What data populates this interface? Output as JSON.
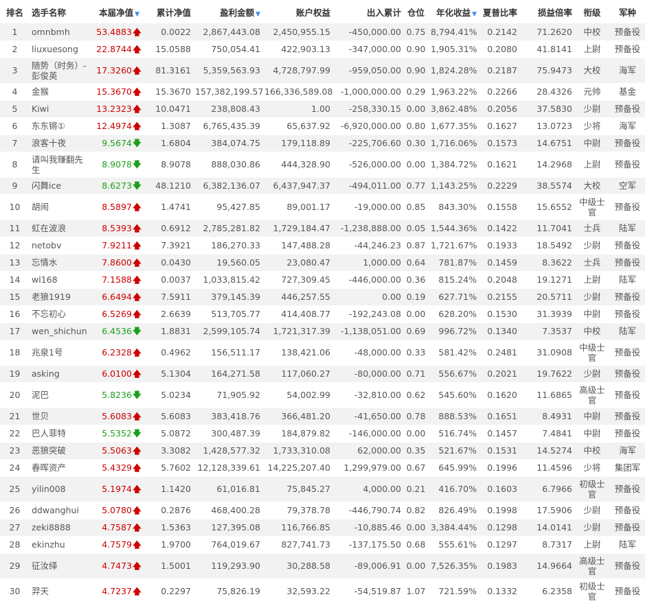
{
  "columns": [
    {
      "label": "排名",
      "sorted": false
    },
    {
      "label": "选手名称",
      "sorted": false
    },
    {
      "label": "本届净值",
      "sorted": true
    },
    {
      "label": "累计净值",
      "sorted": false
    },
    {
      "label": "盈利金额",
      "sorted": true
    },
    {
      "label": "账户权益",
      "sorted": false
    },
    {
      "label": "出入累计",
      "sorted": false
    },
    {
      "label": "仓位",
      "sorted": false
    },
    {
      "label": "年化收益",
      "sorted": true
    },
    {
      "label": "夏普比率",
      "sorted": false
    },
    {
      "label": "损益倍率",
      "sorted": false
    },
    {
      "label": "衔级",
      "sorted": false
    },
    {
      "label": "军种",
      "sorted": false
    }
  ],
  "sort_indicator": "▼",
  "arrows": {
    "up": "🡅",
    "down": "🡇"
  },
  "colors": {
    "up": "#cc0000",
    "down": "#1aa01a",
    "sort": "#3a8ee6",
    "stripe": "#f2f2f2"
  },
  "rows": [
    {
      "rank": "1",
      "name": "omnbmh",
      "nav": "53.4883",
      "dir": "up",
      "cum": "0.0022",
      "profit": "2,867,443.08",
      "equity": "2,450,955.15",
      "flow": "-450,000.00",
      "pos": "0.75",
      "annual": "8,794.41%",
      "sharpe": "0.2142",
      "pl": "71.2620",
      "rank_title": "中校",
      "branch": "预备役"
    },
    {
      "rank": "2",
      "name": "liuxuesong",
      "nav": "22.8744",
      "dir": "up",
      "cum": "15.0588",
      "profit": "750,054.41",
      "equity": "422,903.13",
      "flow": "-347,000.00",
      "pos": "0.90",
      "annual": "1,905.31%",
      "sharpe": "0.2080",
      "pl": "41.8141",
      "rank_title": "上尉",
      "branch": "预备役"
    },
    {
      "rank": "3",
      "name": "随势（时务）-彭俊英",
      "nav": "17.3260",
      "dir": "up",
      "cum": "81.3161",
      "profit": "5,359,563.93",
      "equity": "4,728,797.99",
      "flow": "-959,050.00",
      "pos": "0.90",
      "annual": "1,824.28%",
      "sharpe": "0.2187",
      "pl": "75.9473",
      "rank_title": "大校",
      "branch": "海军"
    },
    {
      "rank": "4",
      "name": "金猴",
      "nav": "15.3670",
      "dir": "up",
      "cum": "15.3670",
      "profit": "157,382,199.57",
      "equity": "166,336,589.08",
      "flow": "-1,000,000.00",
      "pos": "0.29",
      "annual": "1,963.22%",
      "sharpe": "0.2266",
      "pl": "28.4326",
      "rank_title": "元帅",
      "branch": "基金"
    },
    {
      "rank": "5",
      "name": "Kiwi",
      "nav": "13.2323",
      "dir": "up",
      "cum": "10.0471",
      "profit": "238,808.43",
      "equity": "1.00",
      "flow": "-258,330.15",
      "pos": "0.00",
      "annual": "3,862.48%",
      "sharpe": "0.2056",
      "pl": "37.5830",
      "rank_title": "少尉",
      "branch": "预备役"
    },
    {
      "rank": "6",
      "name": "东东锵①",
      "nav": "12.4974",
      "dir": "up",
      "cum": "1.3087",
      "profit": "6,765,435.39",
      "equity": "65,637.92",
      "flow": "-6,920,000.00",
      "pos": "0.80",
      "annual": "1,677.35%",
      "sharpe": "0.1627",
      "pl": "13.0723",
      "rank_title": "少将",
      "branch": "海军"
    },
    {
      "rank": "7",
      "name": "浪客十夜",
      "nav": "9.5674",
      "dir": "down",
      "cum": "1.6804",
      "profit": "384,074.75",
      "equity": "179,118.89",
      "flow": "-225,706.60",
      "pos": "0.30",
      "annual": "1,716.06%",
      "sharpe": "0.1573",
      "pl": "14.6751",
      "rank_title": "中尉",
      "branch": "预备役"
    },
    {
      "rank": "8",
      "name": "请叫我赚翻先生",
      "nav": "8.9078",
      "dir": "down",
      "cum": "8.9078",
      "profit": "888,030.86",
      "equity": "444,328.90",
      "flow": "-526,000.00",
      "pos": "0.00",
      "annual": "1,384.72%",
      "sharpe": "0.1621",
      "pl": "14.2968",
      "rank_title": "上尉",
      "branch": "预备役"
    },
    {
      "rank": "9",
      "name": "闪舞ice",
      "nav": "8.6273",
      "dir": "down",
      "cum": "48.1210",
      "profit": "6,382,136.07",
      "equity": "6,437,947.37",
      "flow": "-494,011.00",
      "pos": "0.77",
      "annual": "1,143.25%",
      "sharpe": "0.2229",
      "pl": "38.5574",
      "rank_title": "大校",
      "branch": "空军"
    },
    {
      "rank": "10",
      "name": "胡闹",
      "nav": "8.5897",
      "dir": "up",
      "cum": "1.4741",
      "profit": "95,427.85",
      "equity": "89,001.17",
      "flow": "-19,000.00",
      "pos": "0.85",
      "annual": "843.30%",
      "sharpe": "0.1558",
      "pl": "15.6552",
      "rank_title": "中级士官",
      "branch": "预备役"
    },
    {
      "rank": "11",
      "name": "虹在波浪",
      "nav": "8.5393",
      "dir": "up",
      "cum": "0.6912",
      "profit": "2,785,281.82",
      "equity": "1,729,184.47",
      "flow": "-1,238,888.00",
      "pos": "0.05",
      "annual": "1,544.36%",
      "sharpe": "0.1422",
      "pl": "11.7041",
      "rank_title": "士兵",
      "branch": "陆军"
    },
    {
      "rank": "12",
      "name": "netobv",
      "nav": "7.9211",
      "dir": "up",
      "cum": "7.3921",
      "profit": "186,270.33",
      "equity": "147,488.28",
      "flow": "-44,246.23",
      "pos": "0.87",
      "annual": "1,721.67%",
      "sharpe": "0.1933",
      "pl": "18.5492",
      "rank_title": "少尉",
      "branch": "预备役"
    },
    {
      "rank": "13",
      "name": "忘情水",
      "nav": "7.8600",
      "dir": "up",
      "cum": "0.0430",
      "profit": "19,560.05",
      "equity": "23,080.47",
      "flow": "1,000.00",
      "pos": "0.64",
      "annual": "781.87%",
      "sharpe": "0.1459",
      "pl": "8.3622",
      "rank_title": "士兵",
      "branch": "预备役"
    },
    {
      "rank": "14",
      "name": "wl168",
      "nav": "7.1588",
      "dir": "up",
      "cum": "0.0037",
      "profit": "1,033,815.42",
      "equity": "727,309.45",
      "flow": "-446,000.00",
      "pos": "0.36",
      "annual": "815.24%",
      "sharpe": "0.2048",
      "pl": "19.1271",
      "rank_title": "上尉",
      "branch": "陆军"
    },
    {
      "rank": "15",
      "name": "老狼1919",
      "nav": "6.6494",
      "dir": "up",
      "cum": "7.5911",
      "profit": "379,145.39",
      "equity": "446,257.55",
      "flow": "0.00",
      "pos": "0.19",
      "annual": "627.71%",
      "sharpe": "0.2155",
      "pl": "20.5711",
      "rank_title": "少尉",
      "branch": "预备役"
    },
    {
      "rank": "16",
      "name": "不忘初心",
      "nav": "6.5269",
      "dir": "up",
      "cum": "2.6639",
      "profit": "513,705.77",
      "equity": "414,408.77",
      "flow": "-192,243.08",
      "pos": "0.00",
      "annual": "628.20%",
      "sharpe": "0.1530",
      "pl": "31.3939",
      "rank_title": "中尉",
      "branch": "预备役"
    },
    {
      "rank": "17",
      "name": "wen_shichun",
      "nav": "6.4536",
      "dir": "down",
      "cum": "1.8831",
      "profit": "2,599,105.74",
      "equity": "1,721,317.39",
      "flow": "-1,138,051.00",
      "pos": "0.69",
      "annual": "996.72%",
      "sharpe": "0.1340",
      "pl": "7.3537",
      "rank_title": "中校",
      "branch": "陆军"
    },
    {
      "rank": "18",
      "name": "兆泉1号",
      "nav": "6.2328",
      "dir": "up",
      "cum": "0.4962",
      "profit": "156,511.17",
      "equity": "138,421.06",
      "flow": "-48,000.00",
      "pos": "0.33",
      "annual": "581.42%",
      "sharpe": "0.2481",
      "pl": "31.0908",
      "rank_title": "中级士官",
      "branch": "预备役"
    },
    {
      "rank": "19",
      "name": "asking",
      "nav": "6.0100",
      "dir": "up",
      "cum": "5.1304",
      "profit": "164,271.58",
      "equity": "117,060.27",
      "flow": "-80,000.00",
      "pos": "0.71",
      "annual": "556.67%",
      "sharpe": "0.2021",
      "pl": "19.7622",
      "rank_title": "少尉",
      "branch": "预备役"
    },
    {
      "rank": "20",
      "name": "泥巴",
      "nav": "5.8236",
      "dir": "down",
      "cum": "5.0234",
      "profit": "71,905.92",
      "equity": "54,002.99",
      "flow": "-32,810.00",
      "pos": "0.62",
      "annual": "545.60%",
      "sharpe": "0.1620",
      "pl": "11.6865",
      "rank_title": "高级士官",
      "branch": "预备役"
    },
    {
      "rank": "21",
      "name": "世贝",
      "nav": "5.6083",
      "dir": "up",
      "cum": "5.6083",
      "profit": "383,418.76",
      "equity": "366,481.20",
      "flow": "-41,650.00",
      "pos": "0.78",
      "annual": "888.53%",
      "sharpe": "0.1651",
      "pl": "8.4931",
      "rank_title": "中尉",
      "branch": "预备役"
    },
    {
      "rank": "22",
      "name": "巴人菲特",
      "nav": "5.5352",
      "dir": "down",
      "cum": "5.0872",
      "profit": "300,487.39",
      "equity": "184,879.82",
      "flow": "-146,000.00",
      "pos": "0.00",
      "annual": "516.74%",
      "sharpe": "0.1457",
      "pl": "7.4841",
      "rank_title": "中尉",
      "branch": "预备役"
    },
    {
      "rank": "23",
      "name": "恶狼突破",
      "nav": "5.5063",
      "dir": "up",
      "cum": "3.3082",
      "profit": "1,428,577.32",
      "equity": "1,733,310.08",
      "flow": "62,000.00",
      "pos": "0.35",
      "annual": "521.67%",
      "sharpe": "0.1531",
      "pl": "14.5274",
      "rank_title": "中校",
      "branch": "海军"
    },
    {
      "rank": "24",
      "name": "春晖资产",
      "nav": "5.4329",
      "dir": "up",
      "cum": "5.7602",
      "profit": "12,128,339.61",
      "equity": "14,225,207.40",
      "flow": "1,299,979.00",
      "pos": "0.67",
      "annual": "645.99%",
      "sharpe": "0.1996",
      "pl": "11.4596",
      "rank_title": "少将",
      "branch": "集团军"
    },
    {
      "rank": "25",
      "name": "yilin008",
      "nav": "5.1974",
      "dir": "up",
      "cum": "1.1420",
      "profit": "61,016.81",
      "equity": "75,845.27",
      "flow": "4,000.00",
      "pos": "0.21",
      "annual": "416.70%",
      "sharpe": "0.1603",
      "pl": "6.7966",
      "rank_title": "初级士官",
      "branch": "预备役"
    },
    {
      "rank": "26",
      "name": "ddwanghui",
      "nav": "5.0780",
      "dir": "up",
      "cum": "0.2876",
      "profit": "468,400.28",
      "equity": "79,378.78",
      "flow": "-446,790.74",
      "pos": "0.82",
      "annual": "826.49%",
      "sharpe": "0.1998",
      "pl": "17.5906",
      "rank_title": "少尉",
      "branch": "预备役"
    },
    {
      "rank": "27",
      "name": "zeki8888",
      "nav": "4.7587",
      "dir": "up",
      "cum": "1.5363",
      "profit": "127,395.08",
      "equity": "116,766.85",
      "flow": "-10,885.46",
      "pos": "0.00",
      "annual": "3,384.44%",
      "sharpe": "0.1298",
      "pl": "14.0141",
      "rank_title": "少尉",
      "branch": "预备役"
    },
    {
      "rank": "28",
      "name": "ekinzhu",
      "nav": "4.7579",
      "dir": "up",
      "cum": "1.9700",
      "profit": "764,019.67",
      "equity": "827,741.73",
      "flow": "-137,175.50",
      "pos": "0.68",
      "annual": "555.61%",
      "sharpe": "0.1297",
      "pl": "8.7317",
      "rank_title": "上尉",
      "branch": "陆军"
    },
    {
      "rank": "29",
      "name": "征汝绎",
      "nav": "4.7473",
      "dir": "up",
      "cum": "1.5001",
      "profit": "119,293.90",
      "equity": "30,288.58",
      "flow": "-89,006.91",
      "pos": "0.00",
      "annual": "7,526.35%",
      "sharpe": "0.1983",
      "pl": "14.9664",
      "rank_title": "高级士官",
      "branch": "预备役"
    },
    {
      "rank": "30",
      "name": "羿天",
      "nav": "4.7237",
      "dir": "up",
      "cum": "0.2297",
      "profit": "75,826.19",
      "equity": "32,593.22",
      "flow": "-54,519.87",
      "pos": "1.07",
      "annual": "721.59%",
      "sharpe": "0.1332",
      "pl": "6.2358",
      "rank_title": "初级士官",
      "branch": "预备役"
    }
  ]
}
